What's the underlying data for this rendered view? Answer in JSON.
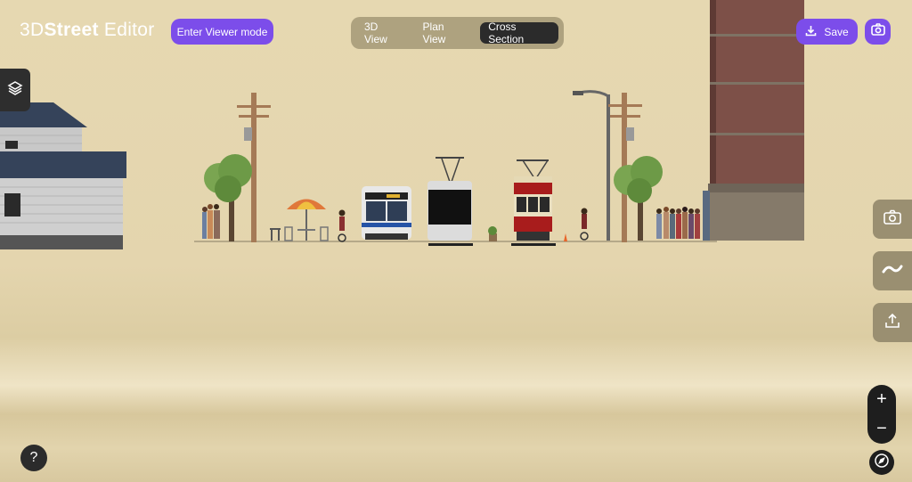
{
  "app": {
    "logo_3d": "3D",
    "logo_street": "Street",
    "logo_editor": " Editor"
  },
  "toolbar": {
    "viewer_mode_label": "Enter Viewer mode",
    "tabs": [
      {
        "label": "3D View",
        "active": false
      },
      {
        "label": "Plan View",
        "active": false
      },
      {
        "label": "Cross Section",
        "active": true
      }
    ],
    "save_label": "Save"
  },
  "help": {
    "label": "?"
  },
  "zoom": {
    "in_label": "+",
    "out_label": "−"
  },
  "icons": {
    "layers": "layers-icon",
    "save": "download-icon",
    "camera": "camera-icon",
    "snapshot": "camera-icon",
    "path": "wave-icon",
    "share": "upload-icon",
    "compass": "compass-icon"
  },
  "scene": {
    "elements": [
      "house",
      "utility-pole",
      "tree",
      "pedestrians",
      "cafe-umbrella",
      "cyclist",
      "bus",
      "trolleybus",
      "planter",
      "streetcar",
      "traffic-cone",
      "street-lamp",
      "brick-building"
    ]
  },
  "colors": {
    "accent": "#7c4dea",
    "sky": "#e6d8b1",
    "panel": "#aea27f",
    "dark": "#2b2b2b"
  }
}
